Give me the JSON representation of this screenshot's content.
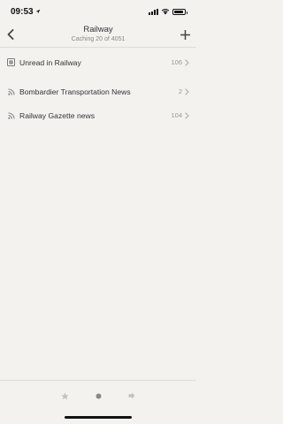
{
  "status_bar": {
    "time": "09:53",
    "battery_level": 0.9
  },
  "nav": {
    "title": "Railway",
    "subtitle": "Caching 20 of 4051",
    "back_icon": "chevron-left-icon",
    "add_icon": "plus-icon"
  },
  "feeds": [
    {
      "label": "Unread in Railway",
      "count": "106",
      "icon": "unread-folder-icon"
    },
    {
      "label": "Bombardier Transportation News",
      "count": "2",
      "icon": "rss-icon"
    },
    {
      "label": "Railway Gazette news",
      "count": "104",
      "icon": "rss-icon"
    }
  ],
  "toolbar": {
    "items": [
      "star-icon",
      "dot-icon",
      "arrow-right-icon"
    ],
    "selected": 1
  },
  "colors": {
    "background": "#f3f2ef",
    "text": "#333333",
    "muted": "#9a9893",
    "divider": "#dedcd7"
  }
}
